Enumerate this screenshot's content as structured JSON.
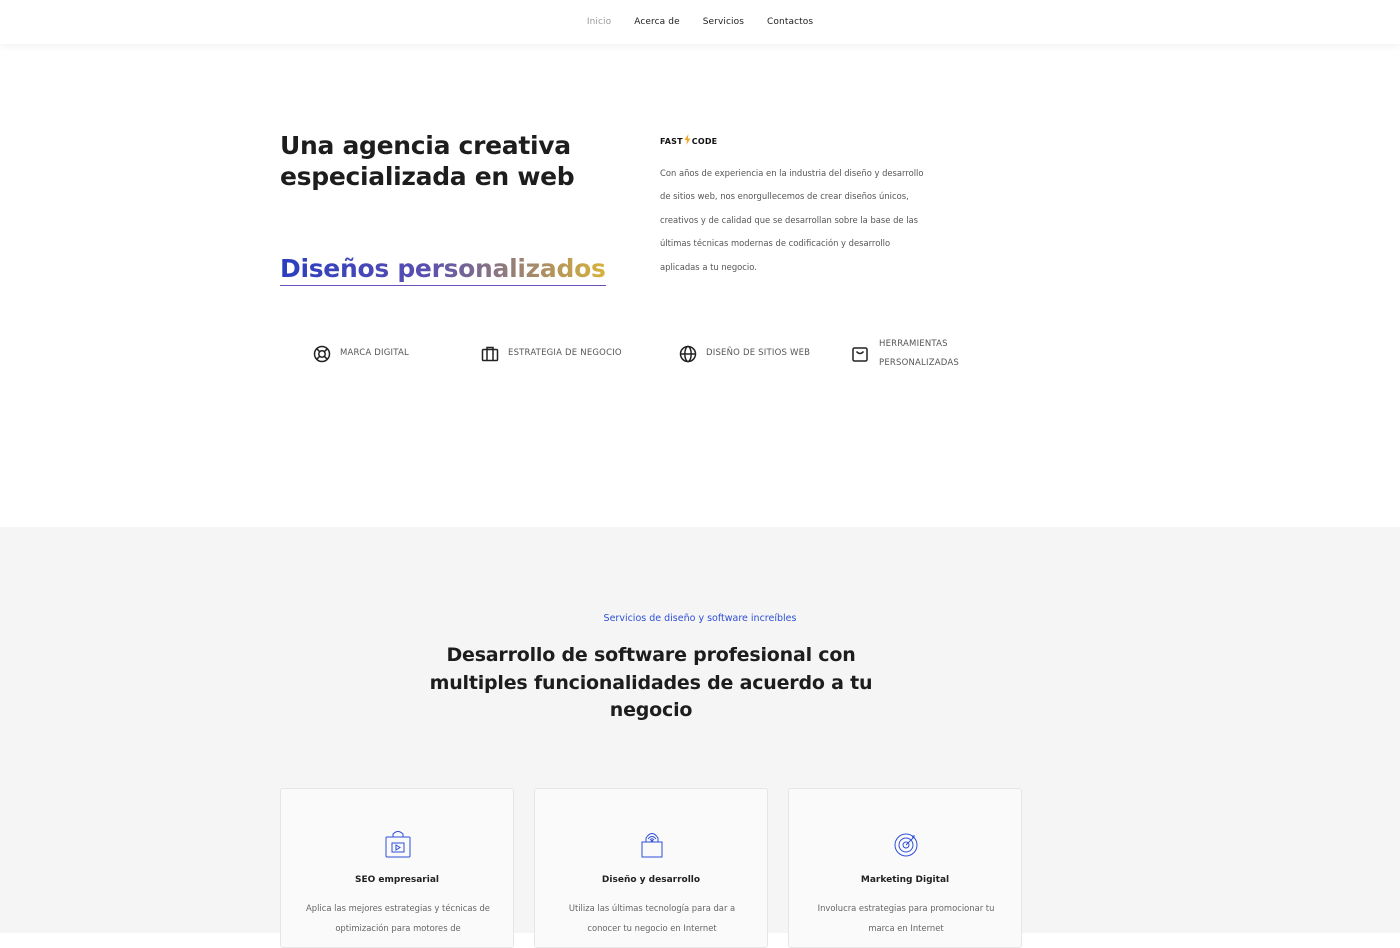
{
  "nav": {
    "items": [
      {
        "label": "Inicio",
        "active": true
      },
      {
        "label": "Acerca de",
        "active": false
      },
      {
        "label": "Servicios",
        "active": false
      },
      {
        "label": "Contactos",
        "active": false
      }
    ]
  },
  "hero": {
    "title": "Una agencia creativa especializada en web",
    "accent": "Diseños personalizados",
    "brand": {
      "left": "FAST",
      "icon": "lightning-bolt-icon",
      "right": "CODE"
    },
    "description": "Con años de experiencia en la industria del diseño y desarrollo de sitios web, nos enorgullecemos de crear diseños únicos, creativos y de calidad que se desarrollan sobre la base de las últimas técnicas modernas de codificación y desarrollo aplicadas a tu negocio."
  },
  "features": [
    {
      "label": "Marca digital",
      "icon": "lifebuoy-icon"
    },
    {
      "label": "Estrategia de negocio",
      "icon": "briefcase-icon"
    },
    {
      "label": "Diseño de sitios web",
      "icon": "globe-icon"
    },
    {
      "label": "Herramientas personalizadas",
      "icon": "shopping-bag-icon"
    }
  ],
  "services": {
    "tag": "Servicios de diseño y software increíbles",
    "title": "Desarrollo de software profesional con multiples funcionalidades de acuerdo a tu negocio",
    "cards": [
      {
        "title": "SEO empresarial",
        "description": "Aplica las mejores estrategias y técnicas de optimización para motores de",
        "icon": "play-bag-icon"
      },
      {
        "title": "Diseño y desarrollo",
        "description": "Utiliza las últimas tecnología para dar a conocer tu negocio en Internet",
        "icon": "wifi-bag-icon"
      },
      {
        "title": "Marketing Digital",
        "description": "Involucra estrategias para promocionar tu marca en Internet",
        "icon": "target-icon"
      }
    ]
  },
  "colors": {
    "accent_blue": "#2f4fd6",
    "gradient_start": "#2a3ec1",
    "gradient_end": "#d8b23a",
    "bolt": "#f5a623",
    "section_bg": "#f5f5f5"
  }
}
